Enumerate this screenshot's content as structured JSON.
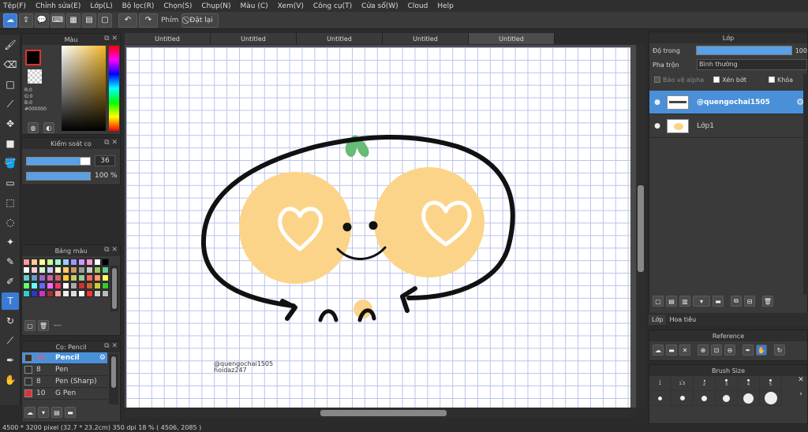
{
  "menu": [
    "Tệp(F)",
    "Chỉnh sửa(E)",
    "Lớp(L)",
    "Bộ lọc(R)",
    "Chọn(S)",
    "Chụp(N)",
    "Màu (C)",
    "Xem(V)",
    "Công cụ(T)",
    "Cửa sổ(W)",
    "Cloud",
    "Help"
  ],
  "toolbar": {
    "phim_label": "Phím",
    "reset_label": "Đặt lại"
  },
  "tabs": [
    "Untitled",
    "Untitled",
    "Untitled",
    "Untitled",
    "Untitled"
  ],
  "color_panel": {
    "title": "Màu",
    "r": "R:0",
    "g": "G:0",
    "b": "B:0",
    "hex": "#000000",
    "foreground": "#000000",
    "background_color": "#ffffff",
    "accent": "#e03030"
  },
  "brush_control": {
    "title": "Kiểm soát cọ",
    "size": "36",
    "opacity": "100 %",
    "size_fraction": 0.85,
    "opacity_fraction": 1.0
  },
  "palette": {
    "title": "Bảng màu",
    "dash": "---",
    "colors": [
      "#ff9999",
      "#ffcc99",
      "#ffff99",
      "#ccff99",
      "#99ffcc",
      "#99ccff",
      "#9999ff",
      "#cc99ff",
      "#ff99cc",
      "#ffffff",
      "#000000",
      "#ffffff",
      "#ffcccc",
      "#ccffcc",
      "#ccccff",
      "#ffffcc",
      "#ffcc66",
      "#cc9966",
      "#999999",
      "#cccccc",
      "#99cc66",
      "#66cc99",
      "#66cccc",
      "#6699cc",
      "#9966cc",
      "#cc6699",
      "#cc6666",
      "#ffcc33",
      "#cccc66",
      "#99cc99",
      "#ff6666",
      "#ff9966",
      "#ffff66",
      "#66ff66",
      "#66ffff",
      "#6666ff",
      "#ff66ff",
      "#ff3366",
      "#ffffff",
      "#aaaaaa",
      "#cc3333",
      "#cc6633",
      "#cccc33",
      "#33cc33",
      "#33cccc",
      "#3333cc",
      "#cc33cc",
      "#993333",
      "#ff9999",
      "#eeeeee",
      "#dddddd",
      "#ffffff",
      "#ff3333",
      "#cccccc",
      "#bbbbbb"
    ]
  },
  "pen_panel": {
    "title": "Cọ: Pencil",
    "pens": [
      {
        "size": "36",
        "name": "Pencil",
        "color": "#333333"
      },
      {
        "size": "8",
        "name": "Pen",
        "color": "#333333"
      },
      {
        "size": "8",
        "name": "Pen (Sharp)",
        "color": "#333333"
      },
      {
        "size": "10",
        "name": "G Pen",
        "color": "#e03030"
      }
    ]
  },
  "canvas": {
    "signature_line1": "@quengochai1505",
    "signature_line2": "hoidaz247",
    "colors": {
      "grid": "#b9c3ee",
      "outline": "#111111",
      "cheek": "#fcd489",
      "heart": "#ffffff",
      "sprout": "#66bb77"
    }
  },
  "layer_panel": {
    "title": "Lớp",
    "opacity_label": "Độ trong",
    "opacity_value": "100",
    "opacity_fraction": 1.0,
    "blend_label": "Pha trộn",
    "blend_value": "Bình thường",
    "protect_alpha": "Bảo vệ alpha",
    "clipping": "Xén bớt",
    "lock": "Khóa",
    "layers": [
      {
        "name": "@quengochai1505",
        "selected": true
      },
      {
        "name": "Lớp1",
        "selected": false
      }
    ],
    "tab_layer": "Lớp",
    "tab_material": "Hoa tiêu"
  },
  "reference": {
    "title": "Reference"
  },
  "brush_size": {
    "title": "Brush Size",
    "row1": [
      "1",
      "1.5",
      "2",
      "3",
      "4",
      "5"
    ],
    "row2": [
      "",
      "",
      "",
      "",
      "",
      ""
    ]
  },
  "status": "4500 * 3200 pixel   (32.7 * 23.2cm)   350 dpi   18 %   ( 4506, 2085 )"
}
